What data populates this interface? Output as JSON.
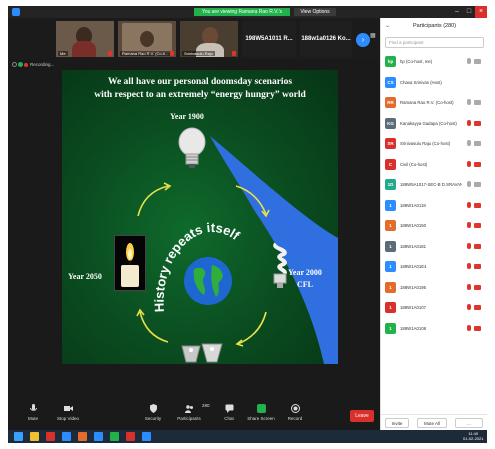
{
  "window": {
    "banner_text": "You are viewing Ramana Rao R.V.'s screen",
    "view_options_label": "View Options",
    "min_glyph": "–",
    "max_glyph": "□",
    "close_glyph": "×"
  },
  "video_strip": {
    "tiles": [
      {
        "name": "Me",
        "muted": true
      },
      {
        "name": "Ramana Rao R.V. (Co-h...",
        "muted": true
      },
      {
        "name": "Srinivasulu Raju",
        "muted": true
      }
    ],
    "name_tiles": [
      "198W5A1011 R...",
      "188w1a0126 Ko..."
    ],
    "next_glyph": "›"
  },
  "recording": {
    "label": "Recording..."
  },
  "slide": {
    "title_line1": "We all have our personal doomsday scenarios",
    "title_line2": "with respect to an extremely “energy hungry” world",
    "year_1900": "Year 1900",
    "year_2050": "Year 2050",
    "year_2000": "Year 2000",
    "cfl": "CFL",
    "center_arc_text": "History repeats itself",
    "colors": {
      "bg": "#0a4a1f",
      "band": "#2f6fe0",
      "arrow": "#e8e04a"
    }
  },
  "toolbar": {
    "mute": "Mute",
    "stop_video": "Stop Video",
    "security": "Security",
    "participants": "Participants",
    "participants_count": "280",
    "chat": "Chat",
    "share_screen": "Share Screen",
    "record": "Record",
    "leave": "Leave"
  },
  "panel": {
    "title": "Participants (280)",
    "collapse_glyph": "⌄",
    "search_placeholder": "Find a participant",
    "participants": [
      {
        "initials": "hp",
        "name": "hp (Co-host, me)",
        "color": "#22b24c",
        "mic": "on",
        "cam": "on"
      },
      {
        "initials": "CS",
        "name": "Chava Srinivas (Host)",
        "color": "#2d8cff",
        "mic": "none",
        "cam": "none"
      },
      {
        "initials": "RR",
        "name": "Ramana Rao R.V. (Co-host)",
        "color": "#e36b2c",
        "mic": "on",
        "cam": "on"
      },
      {
        "initials": "KG",
        "name": "Kanakayya Gadapa (Co-host)",
        "color": "#5a6b7a",
        "mic": "off",
        "cam": "off"
      },
      {
        "initials": "SR",
        "name": "Srinivasulu Raju (Co-host)",
        "color": "#d9302c",
        "mic": "on",
        "cam": "on"
      },
      {
        "initials": "C",
        "name": "Civil (Co-host)",
        "color": "#d9302c",
        "mic": "off",
        "cam": "off"
      },
      {
        "initials": "1D",
        "name": "188W5A1017-SEC-B D.SRAVAN...",
        "color": "#22a88a",
        "mic": "on",
        "cam": "on"
      },
      {
        "initials": "1",
        "name": "188W1A0118",
        "color": "#2d8cff",
        "mic": "off",
        "cam": "off"
      },
      {
        "initials": "1",
        "name": "188W1A0150",
        "color": "#e36b2c",
        "mic": "off",
        "cam": "off"
      },
      {
        "initials": "1",
        "name": "188W1A0181",
        "color": "#5a6b7a",
        "mic": "off",
        "cam": "off"
      },
      {
        "initials": "1",
        "name": "188W1A01E4",
        "color": "#2d8cff",
        "mic": "off",
        "cam": "off"
      },
      {
        "initials": "1",
        "name": "188W1A0195",
        "color": "#e36b2c",
        "mic": "off",
        "cam": "off"
      },
      {
        "initials": "1",
        "name": "188W1A0107",
        "color": "#d9302c",
        "mic": "off",
        "cam": "off"
      },
      {
        "initials": "1",
        "name": "188W1A0108",
        "color": "#22b24c",
        "mic": "off",
        "cam": "off"
      }
    ],
    "invite": "Invite",
    "mute_all": "Mute All",
    "more": "..."
  },
  "taskbar": {
    "time": "11:40",
    "date": "01-02-2021"
  }
}
